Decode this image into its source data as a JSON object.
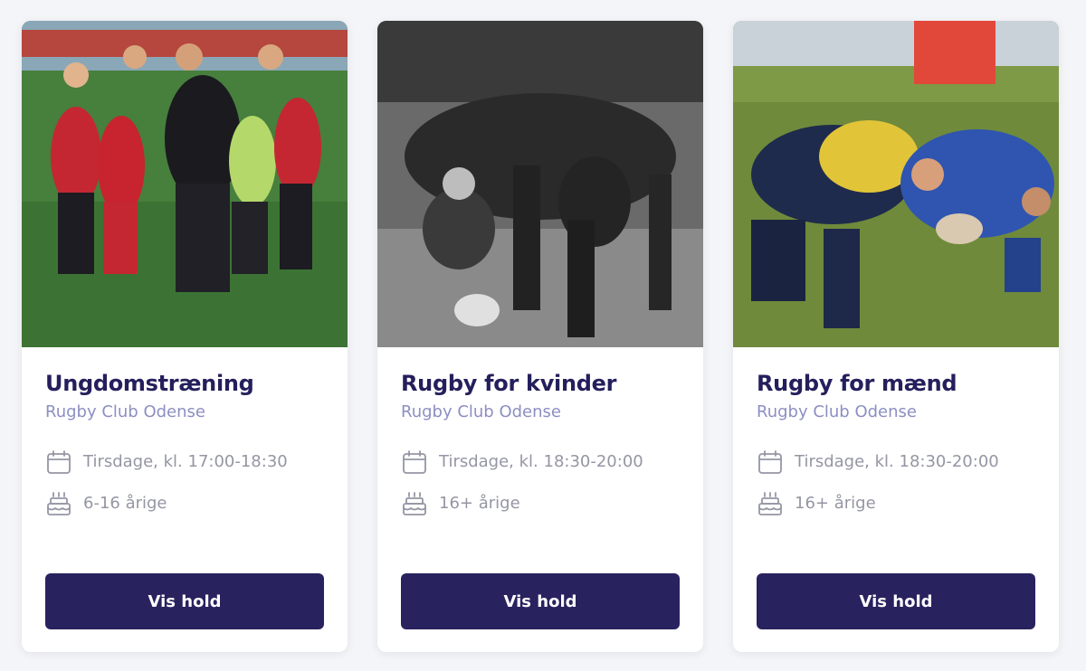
{
  "cards": [
    {
      "title": "Ungdomstræning",
      "club": "Rugby Club Odense",
      "schedule": "Tirsdage, kl. 17:00-18:30",
      "age": "6-16 årige",
      "button_label": "Vis hold",
      "image": "youth rugby team huddle on grass"
    },
    {
      "title": "Rugby for kvinder",
      "club": "Rugby Club Odense",
      "schedule": "Tirsdage, kl. 18:30-20:00",
      "age": "16+ årige",
      "button_label": "Vis hold",
      "image": "black and white women's rugby scrum"
    },
    {
      "title": "Rugby for mænd",
      "club": "Rugby Club Odense",
      "schedule": "Tirsdage, kl. 18:30-20:00",
      "age": "16+ årige",
      "button_label": "Vis hold",
      "image": "men's rugby scrum in yellow and blue"
    }
  ],
  "colors": {
    "title": "#241f5c",
    "club": "#8c8fc2",
    "meta": "#9596a4",
    "button_bg": "#28225e"
  }
}
